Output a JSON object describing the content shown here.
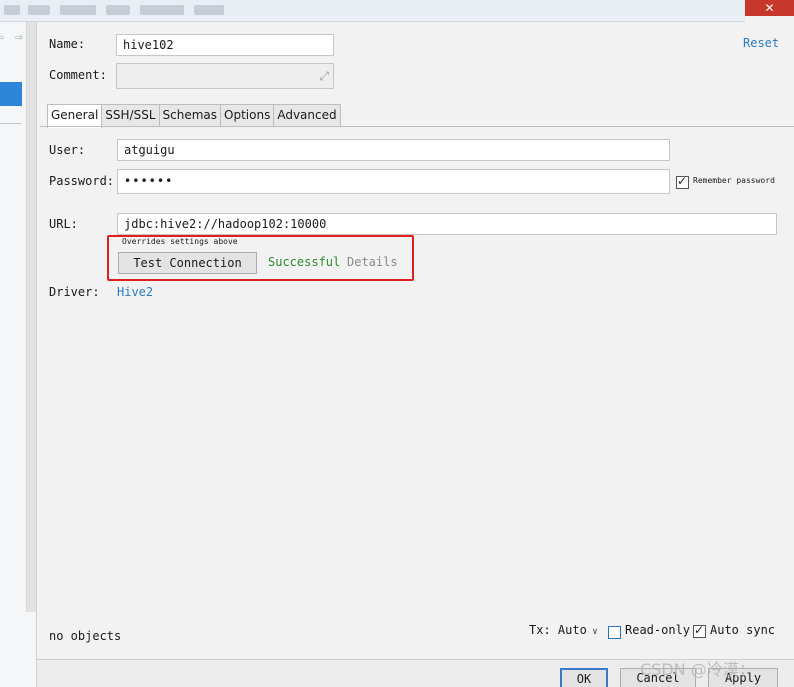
{
  "window": {
    "close_symbol": "✕"
  },
  "nav": {
    "back_icon": "⇦",
    "forward_icon": "⇨"
  },
  "form": {
    "name_label": "Name:",
    "name_value": "hive102",
    "comment_label": "Comment:",
    "comment_value": "",
    "reset_label": "Reset",
    "expand_icon": "⤢"
  },
  "tabs": [
    {
      "label": "General",
      "active": true
    },
    {
      "label": "SSH/SSL",
      "active": false
    },
    {
      "label": "Schemas",
      "active": false
    },
    {
      "label": "Options",
      "active": false
    },
    {
      "label": "Advanced",
      "active": false
    }
  ],
  "general": {
    "user_label": "User:",
    "user_value": "atguigu",
    "password_label": "Password:",
    "password_value": "••••••",
    "remember_label": "Remember password",
    "remember_checked": true,
    "url_label": "URL:",
    "url_value": "jdbc:hive2://hadoop102:10000",
    "url_hint": "Overrides settings above",
    "test_button": "Test Connection",
    "test_status": "Successful",
    "details_label": "Details",
    "driver_label": "Driver:",
    "driver_value": "Hive2"
  },
  "footer": {
    "no_objects": "no objects",
    "tx_label": "Tx: Auto",
    "readonly_label": "Read-only",
    "readonly_checked": false,
    "autosync_label": "Auto sync",
    "autosync_checked": true,
    "ok_button": "OK",
    "cancel_button": "Cancel",
    "apply_button": "Apply"
  },
  "watermark": "CSDN @冷漠；",
  "colors": {
    "accent": "#2e84d8",
    "link": "#2a7ac4",
    "success": "#2e8b2e",
    "highlight": "#e02020",
    "close_button": "#c8372c"
  }
}
